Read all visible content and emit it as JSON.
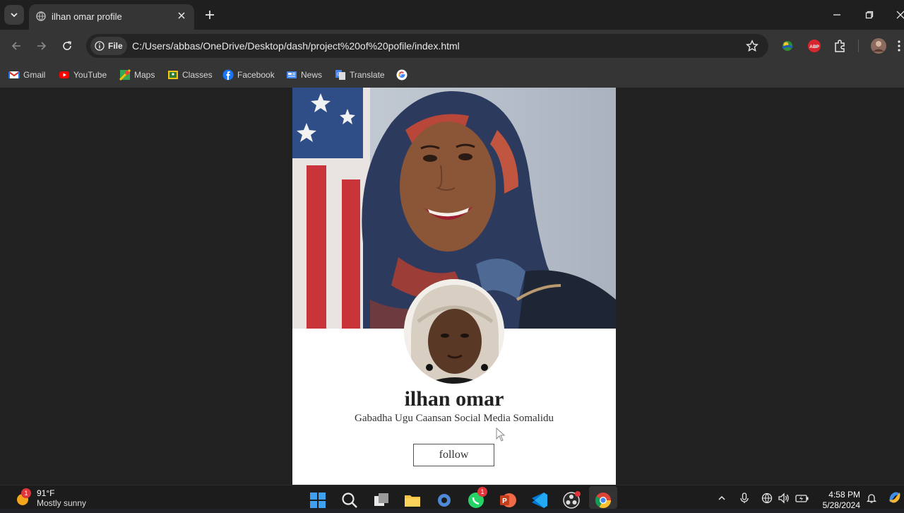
{
  "browser": {
    "tab": {
      "title": "ilhan omar profile"
    },
    "address": {
      "chip_label": "File",
      "url": "C:/Users/abbas/OneDrive/Desktop/dash/project%20of%20pofile/index.html"
    },
    "extensions": {
      "abp_label": "ABP"
    },
    "bookmarks": [
      {
        "label": "Gmail",
        "icon": "gmail-icon"
      },
      {
        "label": "YouTube",
        "icon": "youtube-icon"
      },
      {
        "label": "Maps",
        "icon": "maps-icon"
      },
      {
        "label": "Classes",
        "icon": "classes-icon"
      },
      {
        "label": "Facebook",
        "icon": "facebook-icon"
      },
      {
        "label": "News",
        "icon": "news-icon"
      },
      {
        "label": "Translate",
        "icon": "translate-icon"
      },
      {
        "label": "",
        "icon": "google-icon"
      }
    ]
  },
  "profile": {
    "name": "ilhan omar",
    "bio": "Gabadha Ugu Caansan Social Media Somalidu",
    "follow_label": "follow"
  },
  "taskbar": {
    "weather": {
      "temp": "91°F",
      "condition": "Mostly sunny",
      "badge": "1"
    },
    "whatsapp_badge": "1",
    "clock": {
      "time": "4:58 PM",
      "date": "5/28/2024"
    }
  },
  "colors": {
    "page_background": "#212121",
    "card_background": "#ffffff",
    "browser_chrome": "#353535"
  }
}
